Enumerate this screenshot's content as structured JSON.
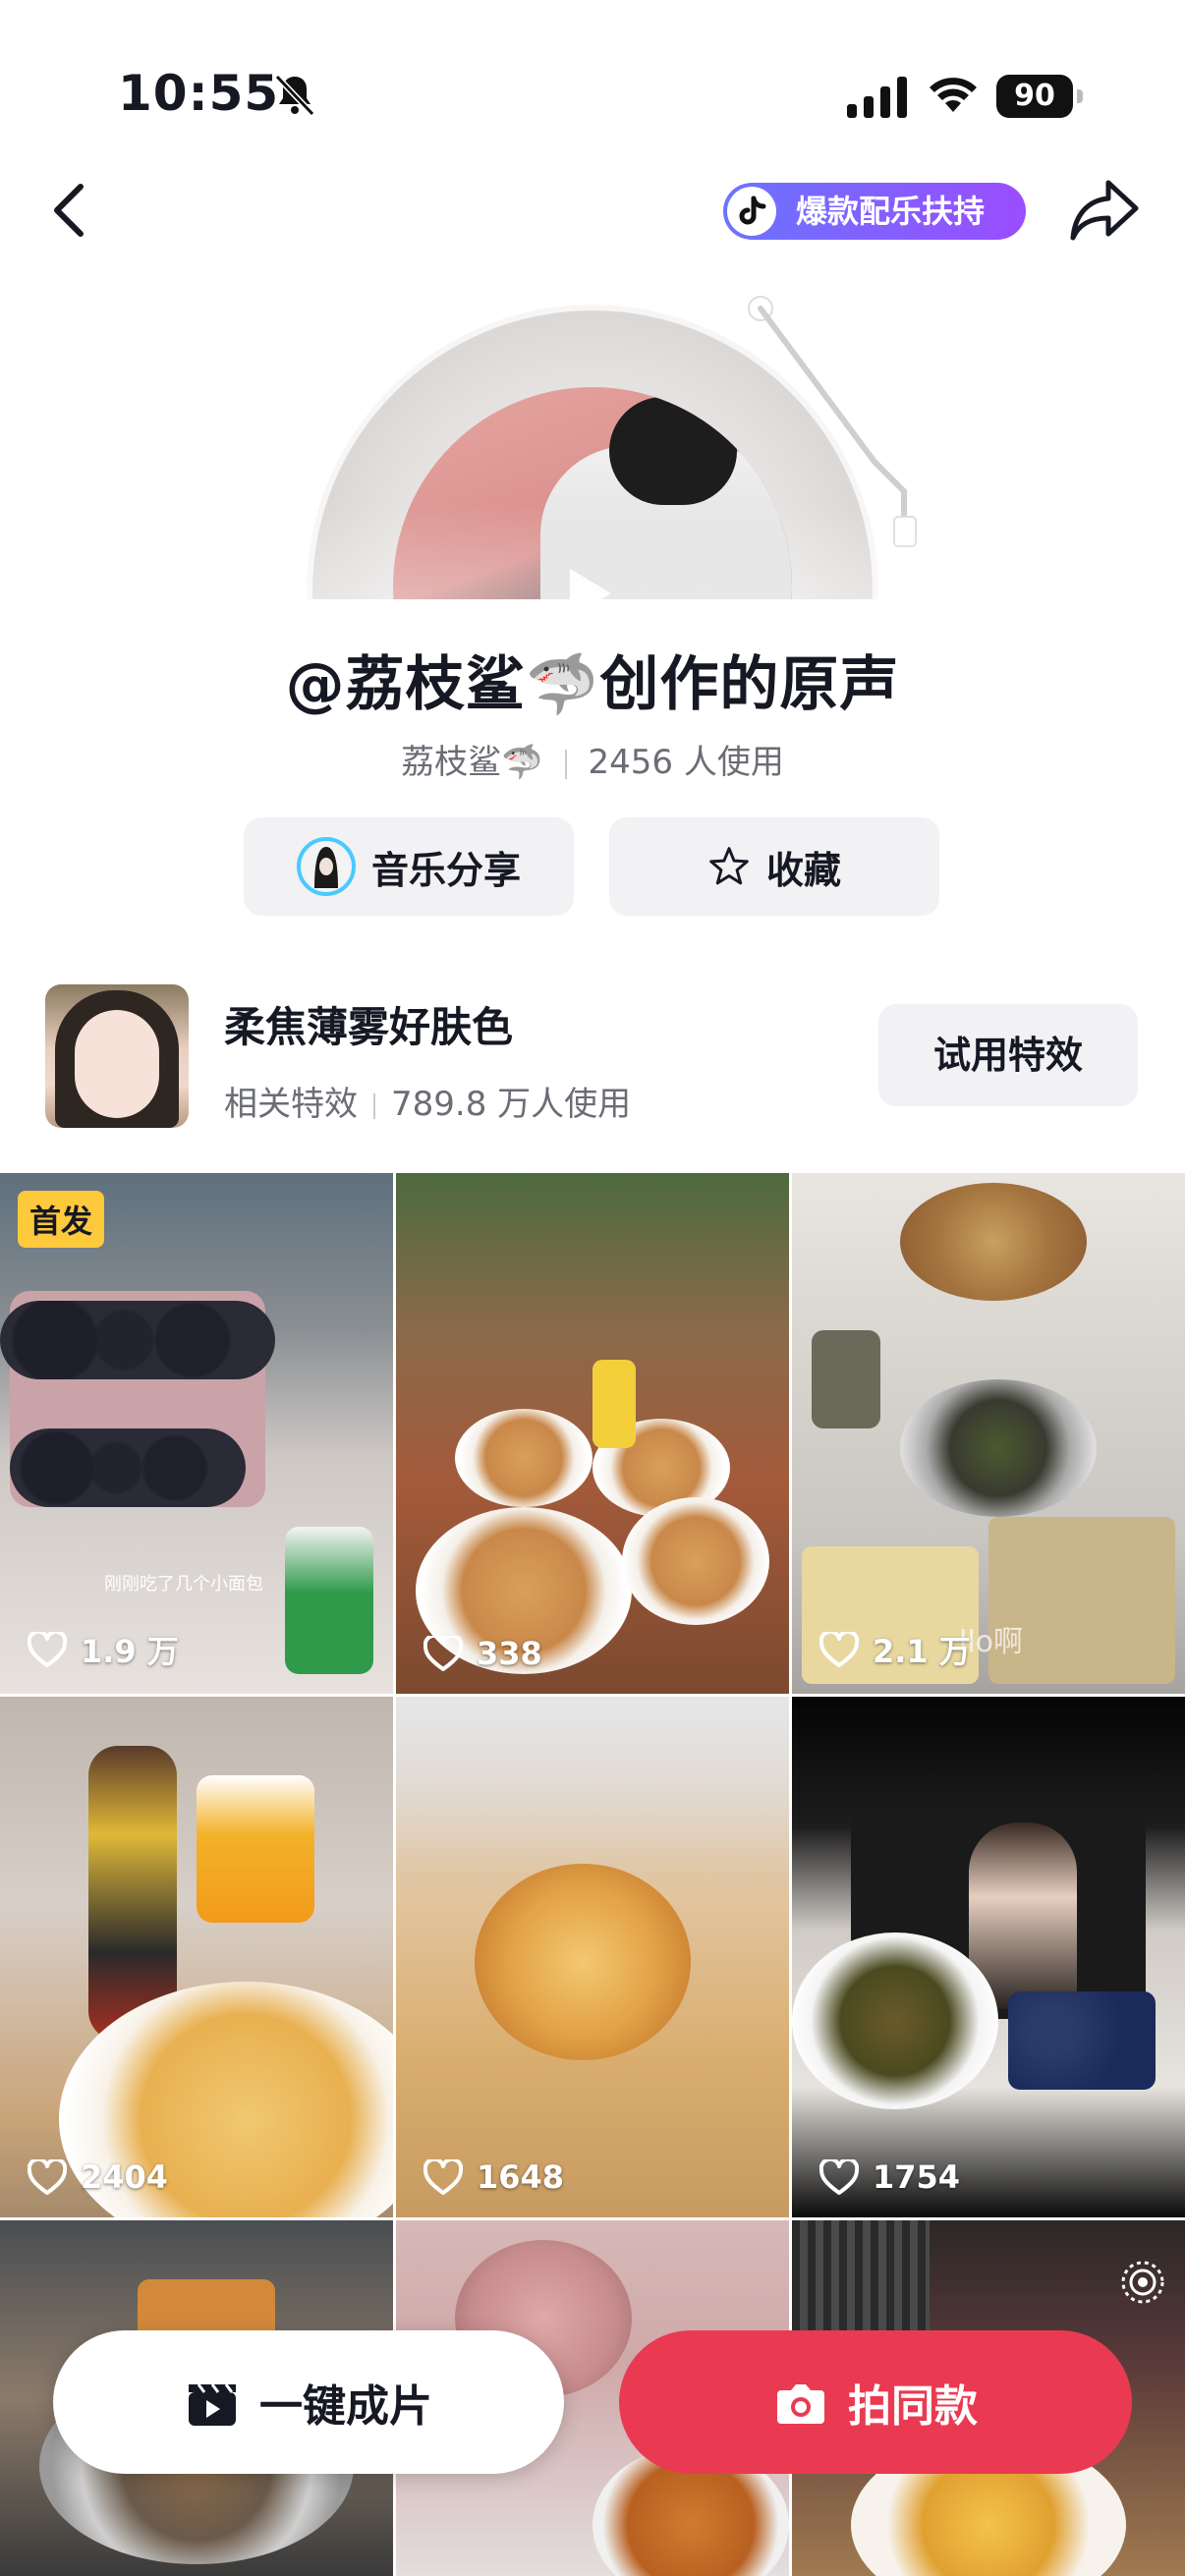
{
  "status_bar": {
    "time": "10:55",
    "battery": "90"
  },
  "header": {
    "promo_label": "爆款配乐扶持"
  },
  "music": {
    "title": "@荔枝鲨🦈创作的原声",
    "author": "荔枝鲨🦈",
    "usage": "2456 人使用",
    "share_label": "音乐分享",
    "favorite_label": "收藏"
  },
  "effect": {
    "name": "柔焦薄雾好肤色",
    "category": "相关特效",
    "usage": "789.8 万人使用",
    "try_label": "试用特效"
  },
  "grid": {
    "first_badge": "首发",
    "items": [
      {
        "likes": "1.9 万",
        "caption": "刚刚吃了几个小面包"
      },
      {
        "likes": "338"
      },
      {
        "likes": "2.1 万",
        "caption": "llo啊"
      },
      {
        "likes": "2404"
      },
      {
        "likes": "1648"
      },
      {
        "likes": "1754"
      },
      {
        "likes": ""
      },
      {
        "likes": ""
      },
      {
        "likes": ""
      }
    ]
  },
  "actions": {
    "one_click_label": "一键成片",
    "shoot_same_label": "拍同款"
  },
  "colors": {
    "accent_red": "#ea3a52",
    "promo_gradient_start": "#6a74ff",
    "promo_gradient_end": "#9a4dff",
    "badge_yellow": "#ffc93c"
  }
}
